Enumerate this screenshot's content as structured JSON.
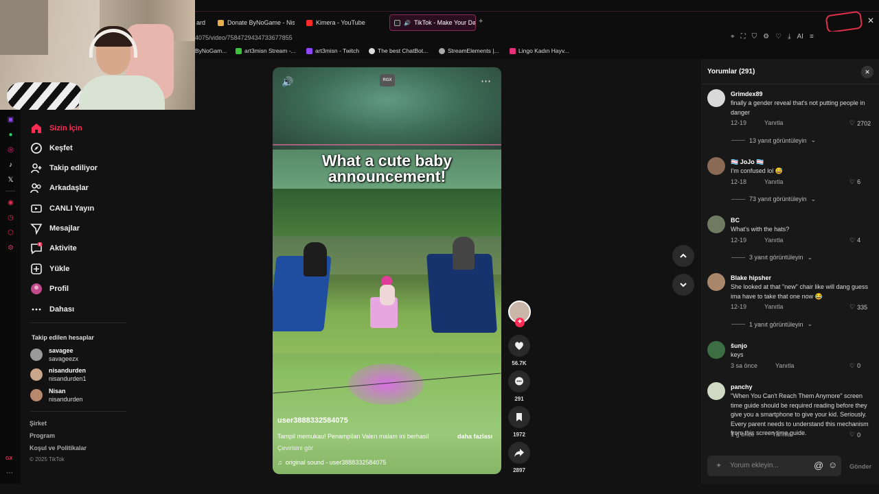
{
  "browser": {
    "tabs": [
      {
        "label": "ard"
      },
      {
        "label": "Donate ByNoGame - Nisa"
      },
      {
        "label": "Kimera - YouTube"
      },
      {
        "label": "TikTok - Make Your Da"
      }
    ],
    "url": "4075/video/7584729434733677855",
    "bookmarks": [
      {
        "label": "ByNoGam..."
      },
      {
        "label": "art3misn Stream -..."
      },
      {
        "label": "art3misn - Twitch"
      },
      {
        "label": "The best ChatBot..."
      },
      {
        "label": "StreamElements |..."
      },
      {
        "label": "Lingo Kadın Hayv..."
      }
    ],
    "ai_label": "AI",
    "gx_label": "GX"
  },
  "sidebar": {
    "items": [
      {
        "label": "Sizin İçin",
        "icon": "home-icon",
        "active": true
      },
      {
        "label": "Keşfet",
        "icon": "compass-icon"
      },
      {
        "label": "Takip ediliyor",
        "icon": "user-plus-icon"
      },
      {
        "label": "Arkadaşlar",
        "icon": "friends-icon"
      },
      {
        "label": "CANLI Yayın",
        "icon": "live-icon"
      },
      {
        "label": "Mesajlar",
        "icon": "send-icon"
      },
      {
        "label": "Aktivite",
        "icon": "activity-icon",
        "badge": "6"
      },
      {
        "label": "Yükle",
        "icon": "upload-icon"
      },
      {
        "label": "Profil",
        "icon": "profile-icon"
      },
      {
        "label": "Dahası",
        "icon": "more-icon"
      }
    ],
    "following_title": "Takip edilen hesaplar",
    "following": [
      {
        "name": "savagee",
        "handle": "savageezx"
      },
      {
        "name": "nisandurden",
        "handle": "nisandurden1"
      },
      {
        "name": "Nisan",
        "handle": "nisandurden"
      }
    ],
    "footer": [
      "Şirket",
      "Program",
      "Koşul ve Politikalar"
    ],
    "copyright": "© 2025 TikTok"
  },
  "video": {
    "caption_overlay_line1": "What a cute baby",
    "caption_overlay_line2": "announcement!",
    "logo": "RGX",
    "username": "user3888332584075",
    "description": "Tampil memukau! Penampilan Valen malam ini berhasil",
    "more": "daha fazlası",
    "translate": "Çevirisini gör",
    "sound": "original sound - user3888332584075",
    "likes": "56.7K",
    "comments": "291",
    "saves": "1972",
    "shares": "2897"
  },
  "comments": {
    "title": "Yorumlar (291)",
    "reply_label": "Yanıtla",
    "items": [
      {
        "name": "Grimdex89",
        "text": "finally a gender reveal that's not putting people in danger",
        "date": "12-19",
        "likes": "2702",
        "replies": "13 yanıt görüntüleyin",
        "avatar": "#d9d9d9"
      },
      {
        "name": "🏳️‍⚧️ JoJo 🏳️‍⚧️",
        "text": "I'm confused lol 😅",
        "date": "12-18",
        "likes": "6",
        "replies": "73 yanıt görüntüleyin",
        "avatar": "#8a6a55"
      },
      {
        "name": "BC",
        "text": "What's with the hats?",
        "date": "12-19",
        "likes": "4",
        "replies": "3 yanıt görüntüleyin",
        "avatar": "#6f7a62"
      },
      {
        "name": "Blake hipsher",
        "text": "She looked at that \"new\" chair like will dang guess ima have to take that one now 😂",
        "date": "12-19",
        "likes": "335",
        "replies": "1 yanıt görüntüleyin",
        "avatar": "#a8866a"
      },
      {
        "name": "šunjo",
        "text": "keys",
        "date": "3 sa önce",
        "likes": "0",
        "replies": "",
        "avatar": "#3d6d43"
      },
      {
        "name": "panchy",
        "text": "\"When You Can't Reach Them Anymore\" screen time guide should be required reading before they give you a smartphone to give your kid. Seriously. Every parent needs to understand this mechanism from this screen time guide.",
        "date": "1 g önce",
        "likes": "0",
        "replies": "",
        "avatar": "#cfd9c4"
      }
    ],
    "input_placeholder": "Yorum ekleyin...",
    "send_label": "Gönder"
  }
}
